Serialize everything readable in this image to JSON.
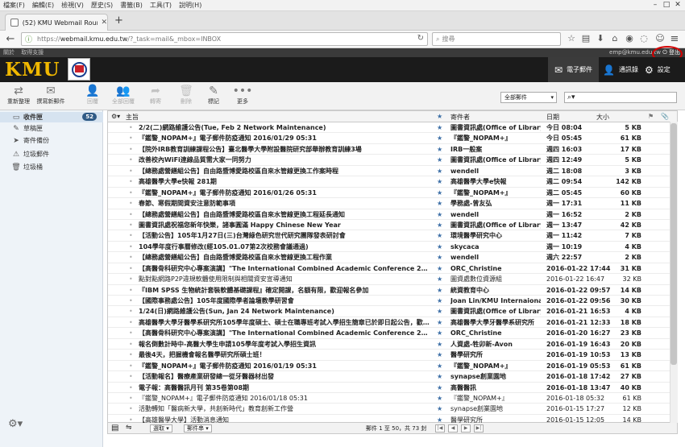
{
  "browser": {
    "menu": [
      "檔案(F)",
      "編輯(E)",
      "檢視(V)",
      "歷史(S)",
      "書籤(B)",
      "工具(T)",
      "說明(H)"
    ],
    "tab_title": "(52) KMU Webmail Roundc...",
    "url_prefix": "https://",
    "url_host": "webmail.kmu.edu.tw",
    "url_path": "/?_task=mail&_mbox=INBOX",
    "search_placeholder": "搜尋"
  },
  "topstrip": {
    "links": [
      "關於",
      "取得支援"
    ],
    "email": "emp@kmu.edu.tw",
    "logout": "登出"
  },
  "header": {
    "logo": "KMU",
    "nav": [
      {
        "label": "電子郵件",
        "icon": "mail-icon",
        "selected": true
      },
      {
        "label": "通訊錄",
        "icon": "person-icon",
        "selected": false
      },
      {
        "label": "設定",
        "icon": "gear-icon",
        "selected": false
      }
    ]
  },
  "toolbar": {
    "buttons": [
      {
        "label": "重新整理",
        "icon": "refresh-icon",
        "enabled": true
      },
      {
        "label": "撰寫新郵件",
        "icon": "compose-icon",
        "enabled": true
      },
      {
        "label": "回覆",
        "icon": "reply-icon",
        "enabled": false
      },
      {
        "label": "全部回覆",
        "icon": "reply-all-icon",
        "enabled": false
      },
      {
        "label": "轉寄",
        "icon": "forward-icon",
        "enabled": false
      },
      {
        "label": "刪除",
        "icon": "delete-icon",
        "enabled": false
      },
      {
        "label": "標記",
        "icon": "mark-icon",
        "enabled": true
      },
      {
        "label": "更多",
        "icon": "more-icon",
        "enabled": true
      }
    ],
    "filter": "全部郵件",
    "search_icon": "search-icon"
  },
  "folders": [
    {
      "name": "收件匣",
      "icon": "inbox-icon",
      "selected": true,
      "count": "52"
    },
    {
      "name": "草稿匣",
      "icon": "pencil-icon",
      "selected": false,
      "count": ""
    },
    {
      "name": "寄件備份",
      "icon": "sent-icon",
      "selected": false,
      "count": ""
    },
    {
      "name": "垃圾郵件",
      "icon": "junk-icon",
      "selected": false,
      "count": ""
    },
    {
      "name": "垃圾桶",
      "icon": "trash-icon",
      "selected": false,
      "count": ""
    }
  ],
  "list": {
    "columns": {
      "subject": "主旨",
      "from": "寄件者",
      "date": "日期",
      "size": "大小"
    },
    "rows": [
      {
        "subject": "2/2(二)網路維護公告(Tue, Feb 2 Network Maintenance)",
        "from": "圖書資訊處(Office of Library...",
        "date": "今日 08:04",
        "size": "5 KB",
        "unread": true
      },
      {
        "subject": "『鑑警_NOPAM+』電子郵件防疫通知 2016/01/29 05:31",
        "from": "『鑑警_NOPAM+』",
        "date": "今日 05:45",
        "size": "61 KB",
        "unread": true
      },
      {
        "subject": "【院外IRB教育訓練課程公告】臺北醫學大學附設醫院研究部舉辦教育訓練3場",
        "from": "IRB一般案",
        "date": "週四 16:03",
        "size": "17 KB",
        "unread": true
      },
      {
        "subject": "改善校內WiFi連線品質需大家一同努力",
        "from": "圖書資訊處(Office of Library...",
        "date": "週四 12:49",
        "size": "5 KB",
        "unread": true
      },
      {
        "subject": "【總務處營繕組公告】自由路暨博愛路校區自來水管線更換工作案時程",
        "from": "wendell",
        "date": "週二 18:08",
        "size": "3 KB",
        "unread": true
      },
      {
        "subject": "高雄醫學大學e快報 281期",
        "from": "高雄醫學大學e快報",
        "date": "週二 09:54",
        "size": "142 KB",
        "unread": true
      },
      {
        "subject": "『鑑警_NOPAM+』電子郵件防疫通知 2016/01/26 05:31",
        "from": "『鑑警_NOPAM+』",
        "date": "週二 05:45",
        "size": "60 KB",
        "unread": true
      },
      {
        "subject": "春節、寒假期間資安注意防範事項",
        "from": "學務處-曾友弘",
        "date": "週一 17:31",
        "size": "11 KB",
        "unread": true
      },
      {
        "subject": "【總務處營繕組公告】自由路暨博愛路校區自來水管線更換工程延長通知",
        "from": "wendell",
        "date": "週一 16:52",
        "size": "2 KB",
        "unread": true
      },
      {
        "subject": "圖書資訊處祝福您新年快樂，諸事圓滿 Happy Chinese New Year",
        "from": "圖書資訊處(Office of Library...",
        "date": "週一 13:47",
        "size": "42 KB",
        "unread": true
      },
      {
        "subject": "【活動公告】105年1月27日(三)台灣綠色研究世代研究團隊發表研討會",
        "from": "環境醫學研究中心",
        "date": "週一 11:42",
        "size": "7 KB",
        "unread": true
      },
      {
        "subject": "104學年度行事曆修改(經105.01.07第2次校務會議通過)",
        "from": "skycaca",
        "date": "週一 10:19",
        "size": "4 KB",
        "unread": true
      },
      {
        "subject": "【總務處營繕組公告】自由路暨博愛路校區自來水管線更換工程作業",
        "from": "wendell",
        "date": "週六 22:57",
        "size": "2 KB",
        "unread": true
      },
      {
        "subject": "【高醫骨科研究中心專案演講】\"The International Combined Academic Conference 2nd Symposium...",
        "from": "ORC_Christine",
        "date": "2016-01-22 17:44",
        "size": "31 KB",
        "unread": true
      },
      {
        "subject": "點對點網路P2P違規軟體使用限制與相關資安宣導通知",
        "from": "圖資處數位資源組",
        "date": "2016-01-22 16:47",
        "size": "32 KB",
        "unread": false
      },
      {
        "subject": "『IBM SPSS 生物統計套裝軟體基礎課程』確定開課，名額有限，歡迎報名參加",
        "from": "統資教育中心",
        "date": "2016-01-22 09:57",
        "size": "14 KB",
        "unread": true
      },
      {
        "subject": "【國際事務處公告】105年度國際學者論壇教學研習會",
        "from": "Joan Lin/KMU Internaional",
        "date": "2016-01-22 09:56",
        "size": "30 KB",
        "unread": true
      },
      {
        "subject": "1/24(日)網路維護公告(Sun, Jan 24 Network Maintenance)",
        "from": "圖書資訊處(Office of Library...",
        "date": "2016-01-21 16:53",
        "size": "4 KB",
        "unread": true
      },
      {
        "subject": "高雄醫學大學牙醫學系研究所105學年度碩士、碩士在職專班考試入學招生簡章已於即日起公告，歡迎報名參加！(歡迎轉發)",
        "from": "高雄醫學大學牙醫學系研究所",
        "date": "2016-01-21 12:33",
        "size": "18 KB",
        "unread": true
      },
      {
        "subject": "【高醫骨科研究中心專案演講】\"The International Combined Academic Conference 2nd Symposium...",
        "from": "ORC_Christine",
        "date": "2016-01-20 16:27",
        "size": "23 KB",
        "unread": true
      },
      {
        "subject": "報名倒數計時中-高醫大學生申請105學年度考試入學招生資訊",
        "from": "人資處-牲卯新-Avon",
        "date": "2016-01-19 16:43",
        "size": "20 KB",
        "unread": true
      },
      {
        "subject": "最後4天，把握機會報名醫學研究所碩士班！",
        "from": "醫學研究所",
        "date": "2016-01-19 10:53",
        "size": "13 KB",
        "unread": true
      },
      {
        "subject": "『鑑警_NOPAM+』電子郵件防疫通知 2016/01/19 05:31",
        "from": "『鑑警_NOPAM+』",
        "date": "2016-01-19 05:53",
        "size": "61 KB",
        "unread": true
      },
      {
        "subject": "【活動報名】醫療產業研發總一從牙醫器材出發",
        "from": "synapse創業園地",
        "date": "2016-01-18 17:42",
        "size": "27 KB",
        "unread": true
      },
      {
        "subject": "電子報：高醫醫訊月刊 第35卷第08期",
        "from": "高醫醫訊",
        "date": "2016-01-18 13:47",
        "size": "40 KB",
        "unread": true
      },
      {
        "subject": "『鑑警_NOPAM+』電子郵件防疫通知 2016/01/18 05:31",
        "from": "『鑑警_NOPAM+』",
        "date": "2016-01-18 05:32",
        "size": "61 KB",
        "unread": false
      },
      {
        "subject": "活動轉知「醫病新大學，共創新時代」教育創新工作營",
        "from": "synapse創業園地",
        "date": "2016-01-15 17:27",
        "size": "12 KB",
        "unread": false
      },
      {
        "subject": "【高雄醫學大學】活動消息通知",
        "from": "醫學研究所",
        "date": "2016-01-15 12:05",
        "size": "14 KB",
        "unread": false
      }
    ]
  },
  "footer": {
    "select_label": "選取",
    "thread_label": "郵件串",
    "count_text": "郵件 1 至 50，共 73 封"
  }
}
